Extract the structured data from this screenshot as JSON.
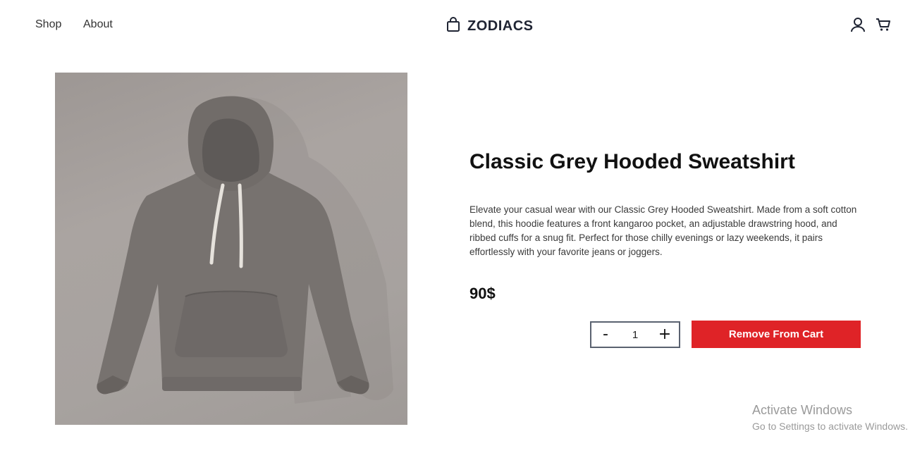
{
  "header": {
    "nav": [
      {
        "label": "Shop"
      },
      {
        "label": "About"
      }
    ],
    "brand": {
      "name": "ZODIACS",
      "icon": "shopping-bag-icon"
    },
    "icons": [
      "user-icon",
      "cart-icon"
    ]
  },
  "product": {
    "image_alt": "Grey hooded sweatshirt",
    "title": "Classic Grey Hooded Sweatshirt",
    "description": "Elevate your casual wear with our Classic Grey Hooded Sweatshirt. Made from a soft cotton blend, this hoodie features a front kangaroo pocket, an adjustable drawstring hood, and ribbed cuffs for a snug fit. Perfect for those chilly evenings or lazy weekends, it pairs effortlessly with your favorite jeans or joggers.",
    "price": "90$",
    "quantity": {
      "decrement_label": "-",
      "value": "1",
      "increment_label": "+"
    },
    "remove_label": "Remove From Cart"
  },
  "watermark": {
    "title": "Activate Windows",
    "subtitle": "Go to Settings to activate Windows."
  },
  "colors": {
    "accent": "#df2327",
    "brand_text": "#1f2433"
  }
}
